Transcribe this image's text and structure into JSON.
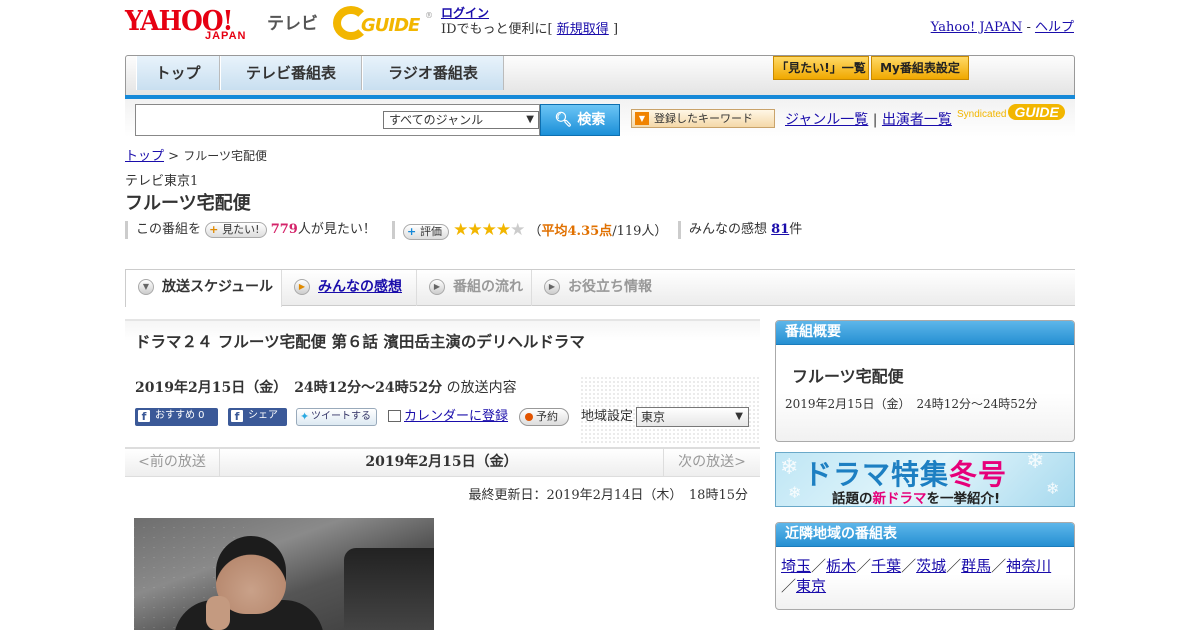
{
  "header": {
    "logo_yahoo": "YAHOO!",
    "logo_japan": "JAPAN",
    "logo_tv": "テレビ",
    "gguide_logo": "GUIDE",
    "login_link": "ログイン",
    "login_prompt": "IDでもっと便利に[",
    "signup_link": "新規取得",
    "login_suffix": "]",
    "yahoo_japan_link": "Yahoo! JAPAN",
    "link_sep": "-",
    "help_link": "ヘルプ"
  },
  "nav": {
    "tabs": [
      {
        "label": "トップ"
      },
      {
        "label": "テレビ番組表"
      },
      {
        "label": "ラジオ番組表"
      }
    ],
    "mitai_list_button": "「見たい!」一覧",
    "my_schedule_button": "My番組表設定"
  },
  "search": {
    "value": "",
    "genre_selected": "すべてのジャンル",
    "search_button": "検索",
    "keyword_button": "登録したキーワード",
    "genre_list_link": "ジャンル一覧",
    "divider": "|",
    "cast_list_link": "出演者一覧",
    "syndicated": "Syndicated",
    "syndicated_logo": "GUIDE"
  },
  "breadcrumb": {
    "home": "トップ",
    "separator": ">",
    "current": "フルーツ宅配便"
  },
  "program": {
    "channel": "テレビ東京1",
    "title": "フルーツ宅配便"
  },
  "stats": {
    "prefix": "この番組を",
    "mitai_button": "見たい!",
    "mitai_count": "779",
    "mitai_suffix": "人が見たい！",
    "rating_button": "評価",
    "stars_filled": "★★★★",
    "stars_empty": "★",
    "rating_open": "（",
    "rating_avg": "平均4.35点",
    "rating_count": "/119人）",
    "impressions_prefix": "みんなの感想",
    "impressions_count": "81",
    "impressions_suffix": "件"
  },
  "subtabs": [
    {
      "label": "放送スケジュール"
    },
    {
      "label": "みんなの感想"
    },
    {
      "label": "番組の流れ"
    },
    {
      "label": "お役立ち情報"
    }
  ],
  "episode": {
    "title": "ドラマ２４ フルーツ宅配便 第６話 濱田岳主演のデリヘルドラマ",
    "datetime": "2019年2月15日（金）　24時12分～24時52分",
    "datetime_suffix": "の放送内容",
    "fb_recommend": "おすすめ 0",
    "fb_share": "シェア",
    "tweet": "ツイートする",
    "calendar": "カレンダーに登録",
    "reserve": "予約",
    "region_label": "地域設定",
    "region_selected": "東京"
  },
  "pager": {
    "prev": "<前の放送",
    "current": "2019年2月15日（金）",
    "next": "次の放送>"
  },
  "updated": "最終更新日：2019年2月14日（木）　18時15分",
  "sidebar": {
    "overview_header": "番組概要",
    "overview_title": "フルーツ宅配便",
    "overview_date": "2019年2月15日（金）　24時12分～24時52分",
    "banner_line1a": "ドラマ特集",
    "banner_line1b": "冬号",
    "banner_line2a": "話題の",
    "banner_line2b": "新ドラマ",
    "banner_line2c": "を一挙紹介!",
    "neighbor_header": "近隣地域の番組表",
    "separator": "／",
    "neighbor_links": [
      "埼玉",
      "栃木",
      "千葉",
      "茨城",
      "群馬",
      "神奈川",
      "東京"
    ]
  },
  "colors": {
    "accent_blue": "#1689d8",
    "yahoo_red": "#e60012",
    "gguide_yellow": "#f2b600",
    "mitai_pink": "#d4246a"
  }
}
